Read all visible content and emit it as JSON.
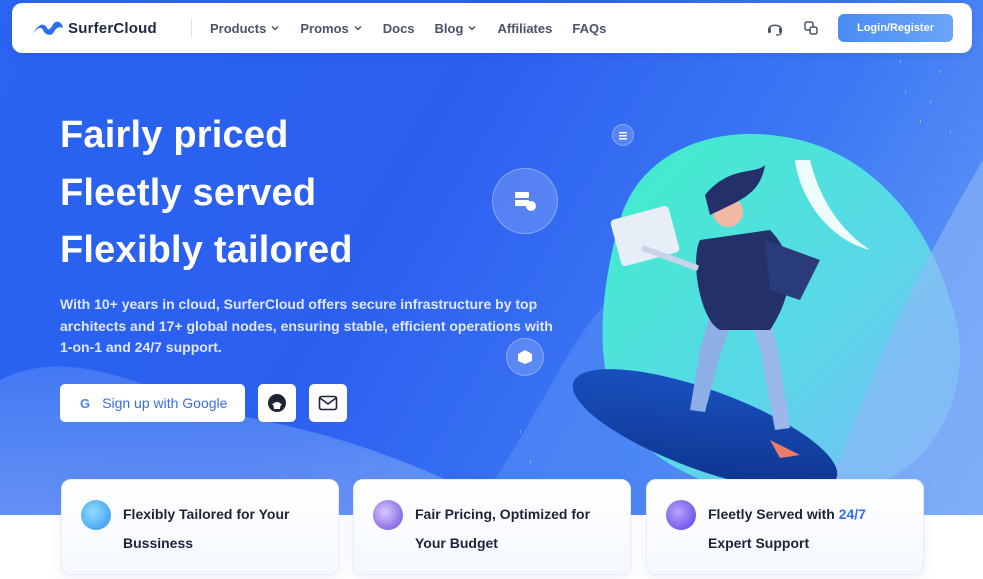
{
  "brand": {
    "name": "SurferCloud"
  },
  "nav": {
    "items": [
      {
        "label": "Products",
        "has_dropdown": true
      },
      {
        "label": "Promos",
        "has_dropdown": true
      },
      {
        "label": "Docs",
        "has_dropdown": false
      },
      {
        "label": "Blog",
        "has_dropdown": true
      },
      {
        "label": "Affiliates",
        "has_dropdown": false
      },
      {
        "label": "FAQs",
        "has_dropdown": false
      }
    ],
    "support_icon": "headset-icon",
    "language_icon": "translate-icon",
    "login_label": "Login/Register"
  },
  "hero": {
    "headlines": [
      "Fairly priced",
      "Fleetly served",
      "Flexibly tailored"
    ],
    "description": "With 10+ years in cloud, SurferCloud offers secure infrastructure by top architects and 17+ global nodes, ensuring stable, efficient operations with 1-on-1 and 24/7 support.",
    "google_button": "Sign up with Google",
    "github_icon": "github-icon",
    "mail_icon": "mail-icon"
  },
  "features": [
    {
      "line1": "Flexibly Tailored for Your",
      "line2": "Bussiness",
      "icon": "globe-icon"
    },
    {
      "line1": "Fair Pricing, Optimized for",
      "line2": "Your Budget",
      "icon": "layers-icon"
    },
    {
      "line1_prefix": "Fleetly Served with ",
      "line1_highlight": "24/7",
      "line2": "Expert Support",
      "icon": "headset-icon"
    }
  ],
  "colors": {
    "hero_blue": "#2b5ff0",
    "accent": "#2f6ef0",
    "login_button": "#5a99f6",
    "teal_blob": "#3ef0c8"
  }
}
